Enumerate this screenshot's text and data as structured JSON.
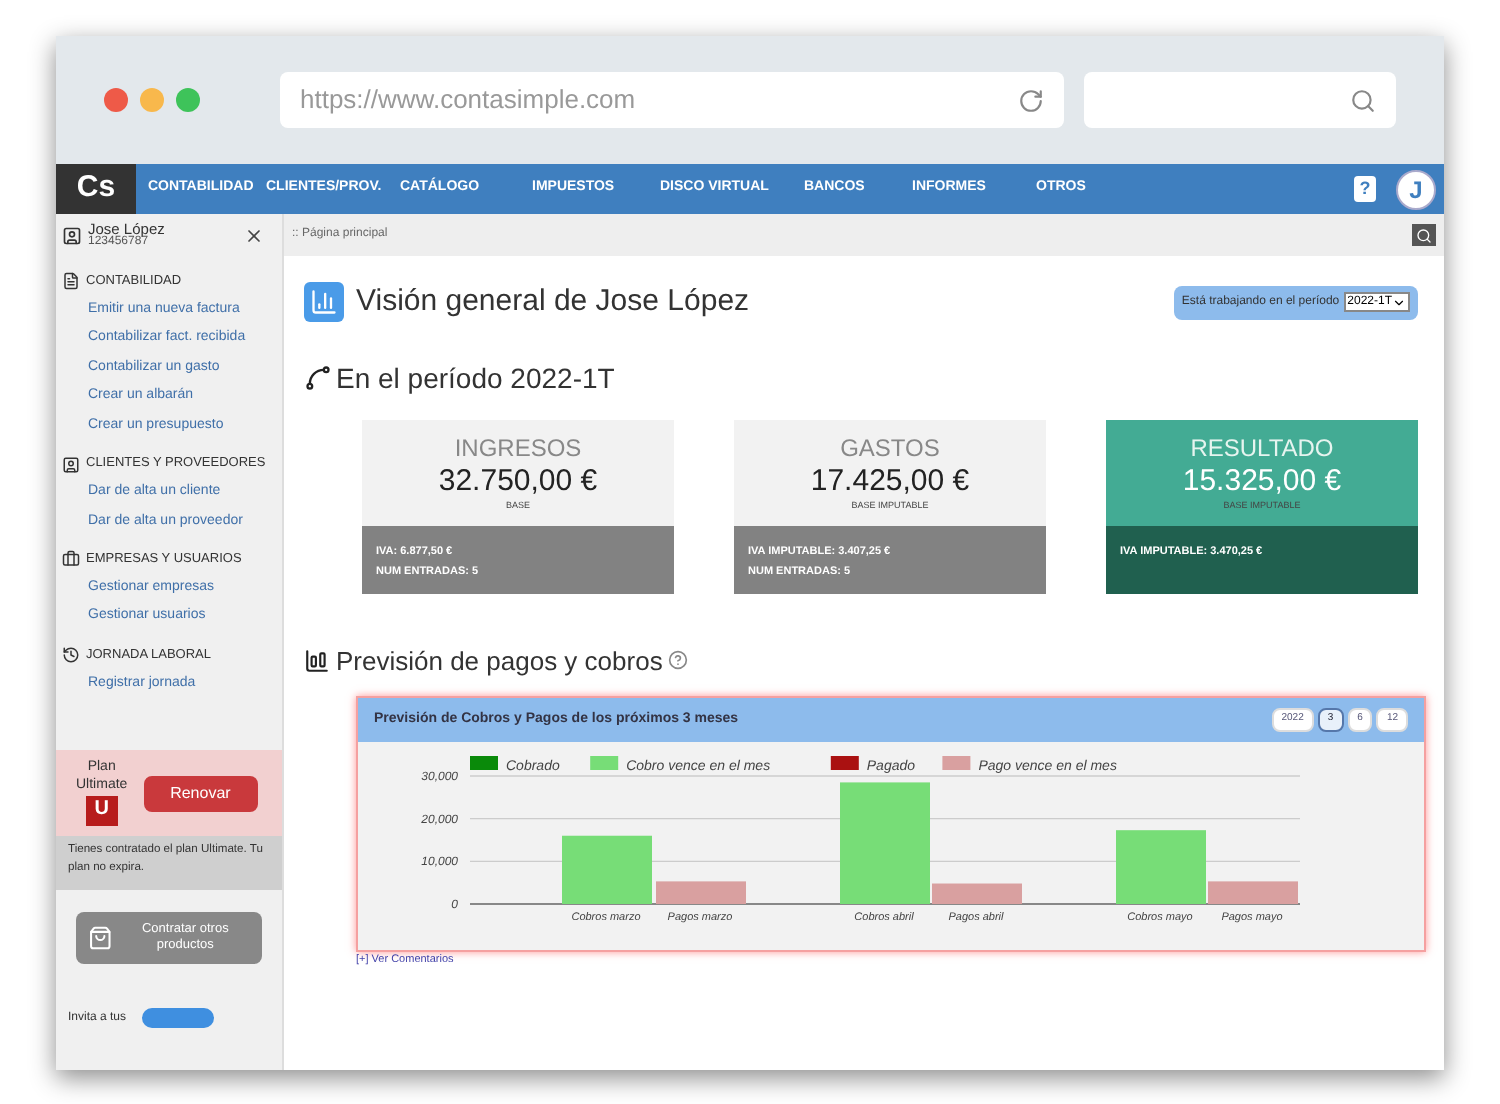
{
  "browser": {
    "url": "https://www.contasimple.com"
  },
  "logo": "Cs",
  "nav": {
    "items": [
      "CONTABILIDAD",
      "CLIENTES/PROV.",
      "CATÁLOGO",
      "IMPUESTOS",
      "DISCO VIRTUAL",
      "BANCOS",
      "INFORMES",
      "OTROS"
    ],
    "help": "?",
    "avatar": "J"
  },
  "user": {
    "name": "Jose López",
    "id": "123456787"
  },
  "breadcrumb": ":: Página principal",
  "sidebar": {
    "sections": [
      {
        "title": "CONTABILIDAD",
        "kind": "doc",
        "links": [
          "Emitir una nueva factura",
          "Contabilizar fact. recibida",
          "Contabilizar un gasto",
          "Crear un albarán",
          "Crear un presupuesto"
        ]
      },
      {
        "title": "CLIENTES Y PROVEEDORES",
        "kind": "badge",
        "links": [
          "Dar de alta un cliente",
          "Dar de alta un proveedor"
        ]
      },
      {
        "title": "EMPRESAS Y USUARIOS",
        "kind": "case",
        "links": [
          "Gestionar empresas",
          "Gestionar usuarios"
        ]
      },
      {
        "title": "JORNADA LABORAL",
        "kind": "history",
        "links": [
          "Registrar jornada"
        ]
      }
    ],
    "plan": {
      "label": "Plan",
      "name": "Ultimate",
      "letter": "U",
      "renew": "Renovar",
      "note": "Tienes contratado el plan Ultimate. Tu plan no expira."
    },
    "products_button": "Contratar otros productos",
    "invite": "Invita a tus"
  },
  "title": "Visión general de Jose López",
  "period": {
    "label": "Está trabajando en el período",
    "value": "2022-1T"
  },
  "period_heading": "En el período 2022-1T",
  "cards": [
    {
      "title": "INGRESOS",
      "amount": "32.750,00 €",
      "sub": "BASE",
      "highlight": false,
      "lines": [
        {
          "label": "IVA:",
          "value": "6.877,50 €"
        },
        {
          "label": "NUM ENTRADAS:",
          "value": "5"
        }
      ]
    },
    {
      "title": "GASTOS",
      "amount": "17.425,00 €",
      "sub": "BASE IMPUTABLE",
      "highlight": false,
      "lines": [
        {
          "label": "IVA IMPUTABLE:",
          "value": "3.407,25 €"
        },
        {
          "label": "NUM ENTRADAS:",
          "value": "5"
        }
      ]
    },
    {
      "title": "RESULTADO",
      "amount": "15.325,00 €",
      "sub": "BASE IMPUTABLE",
      "highlight": true,
      "lines": [
        {
          "label": "IVA IMPUTABLE:",
          "value": "3.470,25 €"
        }
      ]
    }
  ],
  "forecast": {
    "heading": "Previsión de pagos y cobros",
    "panel_title": "Previsión de Cobros y Pagos de los próximos 3 meses",
    "ranges": [
      {
        "label": "2022",
        "selected": false
      },
      {
        "label": "3",
        "selected": true
      },
      {
        "label": "6",
        "selected": false
      },
      {
        "label": "12",
        "selected": false
      }
    ],
    "chart_data": {
      "type": "bar",
      "categories": [
        "Cobros marzo",
        "Pagos marzo",
        "Cobros abril",
        "Pagos abril",
        "Cobros mayo",
        "Pagos mayo"
      ],
      "series": [
        {
          "name": "Cobrado",
          "color": "#0a8a0a",
          "values": [
            null,
            null,
            null,
            null,
            null,
            null
          ]
        },
        {
          "name": "Cobro vence en el mes",
          "color": "#77dd77",
          "values": [
            16000,
            null,
            28500,
            null,
            17300,
            null
          ]
        },
        {
          "name": "Pagado",
          "color": "#aa1111",
          "values": [
            null,
            null,
            null,
            null,
            null,
            null
          ]
        },
        {
          "name": "Pago vence en el mes",
          "color": "#d9a0a0",
          "values": [
            null,
            5300,
            null,
            4800,
            null,
            5300
          ]
        }
      ],
      "legend": "top",
      "ylim": [
        0,
        30000
      ],
      "yticks": [
        {
          "value": 0,
          "label": "0"
        },
        {
          "value": 10000,
          "label": "10,000"
        },
        {
          "value": 20000,
          "label": "20,000"
        },
        {
          "value": 30000,
          "label": "30,000"
        }
      ],
      "stacked": true
    },
    "comments_link": "[+] Ver Comentarios"
  }
}
